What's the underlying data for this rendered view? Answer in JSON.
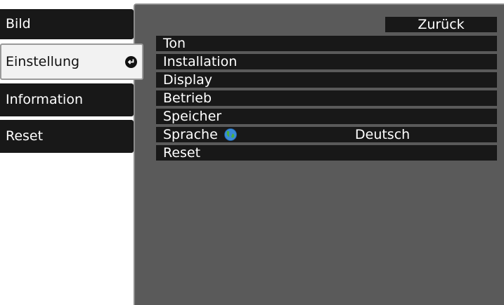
{
  "sidebar": {
    "items": [
      {
        "label": "Bild"
      },
      {
        "label": "Einstellung"
      },
      {
        "label": "Information"
      },
      {
        "label": "Reset"
      }
    ]
  },
  "submenu": {
    "back_label": "Zurück",
    "items": [
      {
        "label": "Ton"
      },
      {
        "label": "Installation"
      },
      {
        "label": "Display"
      },
      {
        "label": "Betrieb"
      },
      {
        "label": "Speicher"
      },
      {
        "label": "Sprache",
        "value": "Deutsch",
        "icon": "globe-icon"
      },
      {
        "label": "Reset"
      }
    ]
  },
  "colors": {
    "menu_bg": "#181818",
    "panel_bg": "#5a5a5a",
    "selected_tab_bg": "#f2f2f2"
  }
}
